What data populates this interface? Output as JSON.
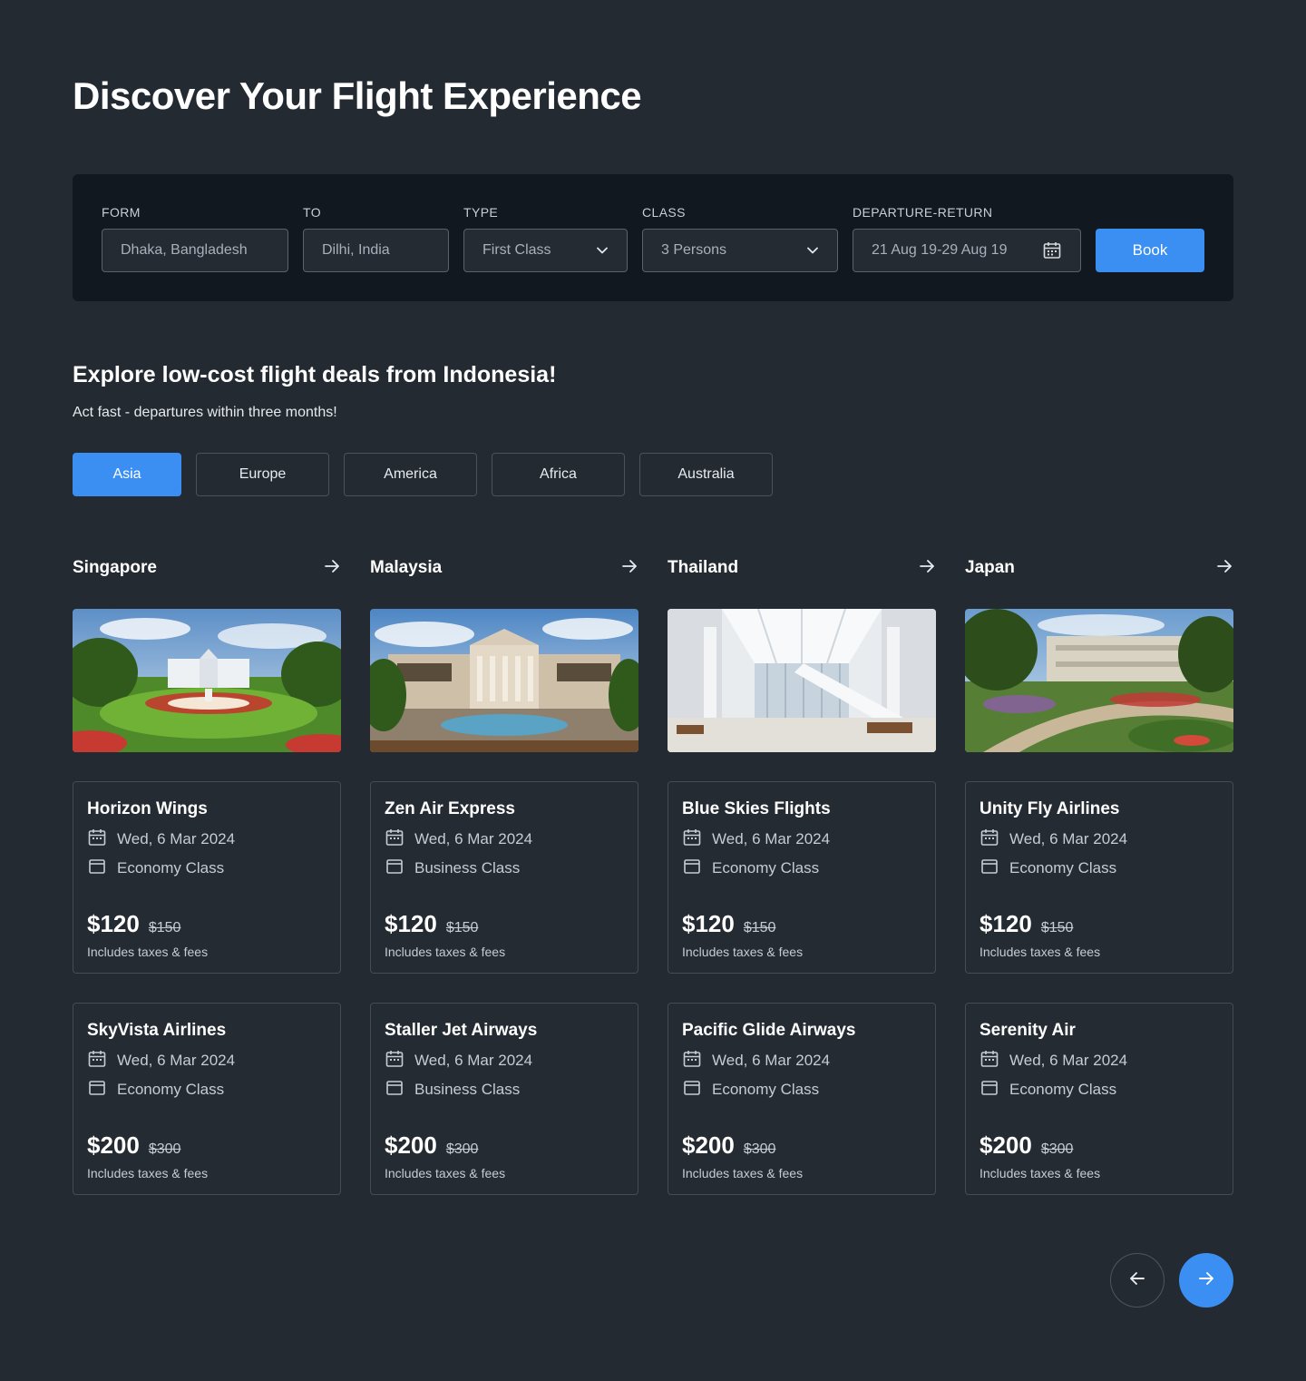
{
  "page_title": "Discover Your Flight Experience",
  "search": {
    "from": {
      "label": "FORM",
      "value": "Dhaka, Bangladesh"
    },
    "to": {
      "label": "TO",
      "value": "Dilhi, India"
    },
    "type": {
      "label": "TYPE",
      "value": "First Class",
      "icon": "chevron-down-icon"
    },
    "class": {
      "label": "CLASS",
      "value": "3 Persons",
      "icon": "chevron-down-icon"
    },
    "dates": {
      "label": "DEPARTURE-RETURN",
      "value": "21 Aug 19-29 Aug 19",
      "icon": "calendar-icon"
    },
    "book_label": "Book"
  },
  "deals": {
    "title": "Explore low-cost flight deals from Indonesia!",
    "subtitle": "Act fast - departures within three months!",
    "tabs": [
      "Asia",
      "Europe",
      "America",
      "Africa",
      "Australia"
    ],
    "active_tab": "Asia"
  },
  "destinations": [
    {
      "name": "Singapore",
      "cards": [
        {
          "airline": "Horizon Wings",
          "date": "Wed, 6 Mar 2024",
          "class": "Economy Class",
          "price": "$120",
          "old_price": "$150",
          "note": "Includes taxes & fees"
        },
        {
          "airline": "SkyVista Airlines",
          "date": "Wed, 6 Mar 2024",
          "class": "Economy Class",
          "price": "$200",
          "old_price": "$300",
          "note": "Includes taxes & fees"
        }
      ]
    },
    {
      "name": "Malaysia",
      "cards": [
        {
          "airline": "Zen Air Express",
          "date": "Wed, 6 Mar 2024",
          "class": "Business Class",
          "price": "$120",
          "old_price": "$150",
          "note": "Includes taxes & fees"
        },
        {
          "airline": "Staller Jet Airways",
          "date": "Wed, 6 Mar 2024",
          "class": "Business Class",
          "price": "$200",
          "old_price": "$300",
          "note": "Includes taxes & fees"
        }
      ]
    },
    {
      "name": "Thailand",
      "cards": [
        {
          "airline": "Blue Skies Flights",
          "date": "Wed, 6 Mar 2024",
          "class": "Economy Class",
          "price": "$120",
          "old_price": "$150",
          "note": "Includes taxes & fees"
        },
        {
          "airline": "Pacific Glide Airways",
          "date": "Wed, 6 Mar 2024",
          "class": "Economy Class",
          "price": "$200",
          "old_price": "$300",
          "note": "Includes taxes & fees"
        }
      ]
    },
    {
      "name": "Japan",
      "cards": [
        {
          "airline": "Unity Fly Airlines",
          "date": "Wed, 6 Mar 2024",
          "class": "Economy Class",
          "price": "$120",
          "old_price": "$150",
          "note": "Includes taxes & fees"
        },
        {
          "airline": "Serenity Air",
          "date": "Wed, 6 Mar 2024",
          "class": "Economy Class",
          "price": "$200",
          "old_price": "$300",
          "note": "Includes taxes & fees"
        }
      ]
    }
  ],
  "pagination": {
    "prev_icon": "arrow-left-icon",
    "next_icon": "arrow-right-icon"
  },
  "colors": {
    "background": "#242a32",
    "panel": "#111820",
    "accent": "#3b8ff3",
    "card_border": "#444c56"
  }
}
